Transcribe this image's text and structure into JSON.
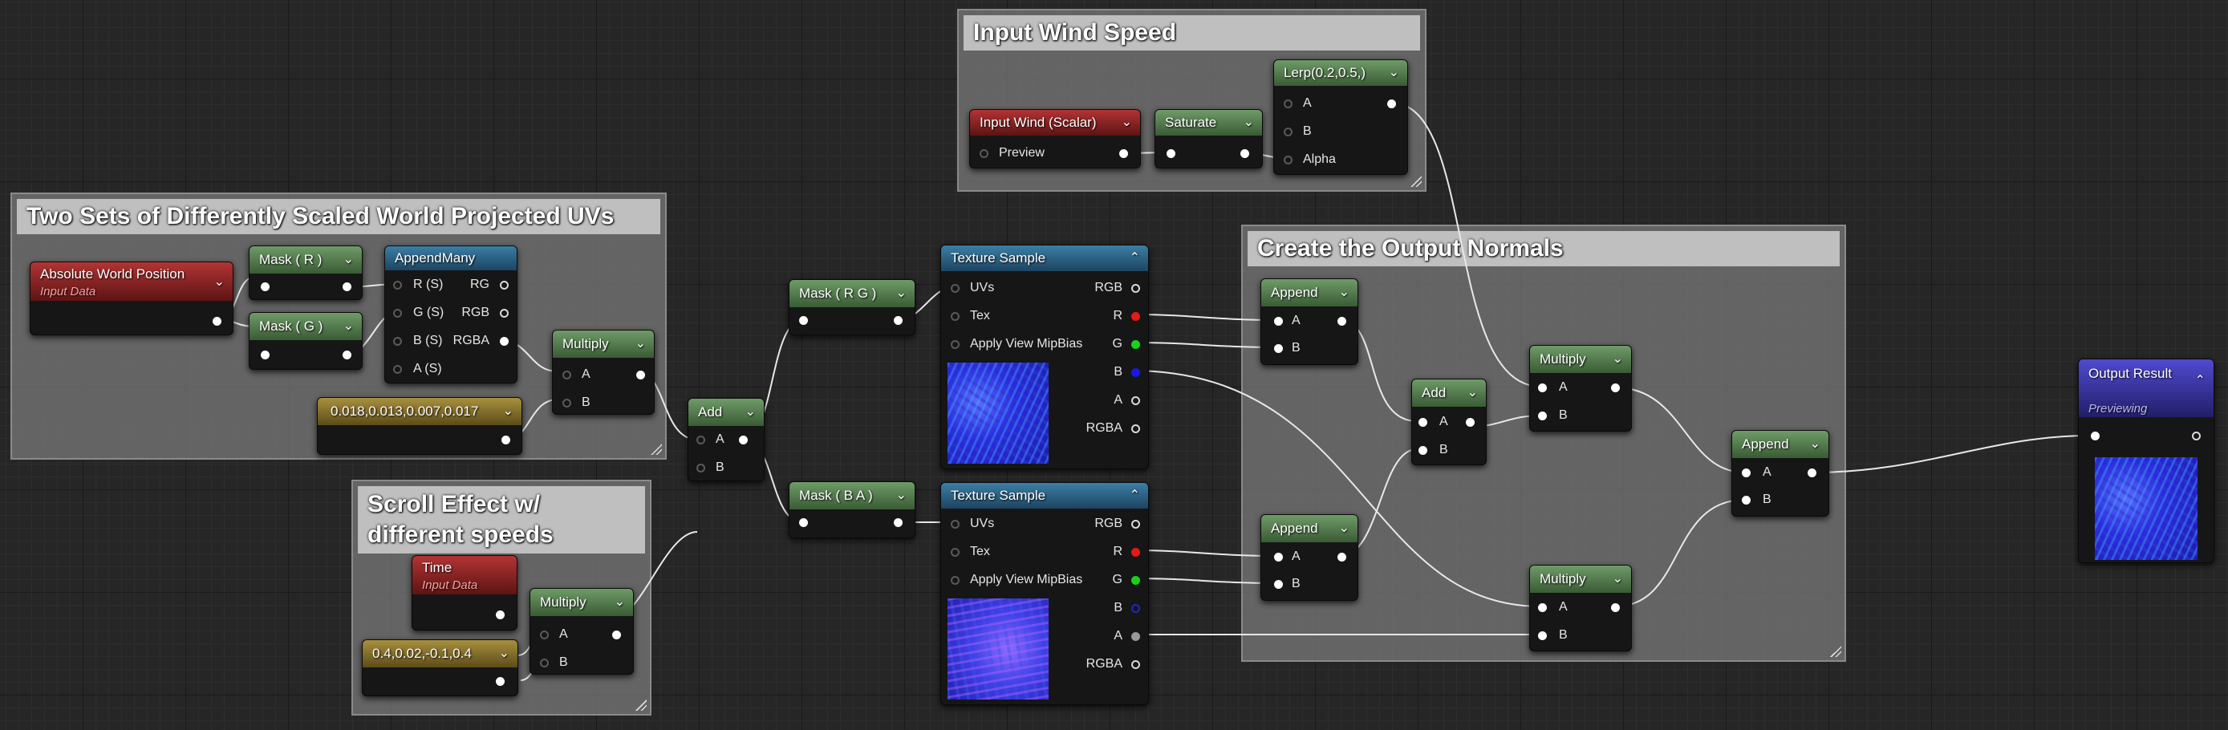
{
  "comments": {
    "wind": "Input Wind Speed",
    "uvs": "Two Sets of Differently Scaled World Projected UVs",
    "scroll": "Scroll Effect w/\ndifferent speeds",
    "normals": "Create the Output Normals"
  },
  "nodes": {
    "abs_world": {
      "title": "Absolute World Position",
      "sub": "Input Data"
    },
    "mask_r": {
      "title": "Mask ( R )"
    },
    "mask_g": {
      "title": "Mask ( G )"
    },
    "append_many": {
      "title": "AppendMany",
      "inputs": [
        "R (S)",
        "G (S)",
        "B (S)",
        "A (S)"
      ],
      "outputs": [
        "RG",
        "RGB",
        "RGBA"
      ]
    },
    "multiply_uv": {
      "title": "Multiply",
      "a": "A",
      "b": "B"
    },
    "const_scale": {
      "title": "0.018,0.013,0.007,0.017"
    },
    "time": {
      "title": "Time",
      "sub": "Input Data"
    },
    "multiply_time": {
      "title": "Multiply",
      "a": "A",
      "b": "B"
    },
    "const_speed": {
      "title": "0.4,0.02,-0.1,0.4"
    },
    "add_main": {
      "title": "Add",
      "a": "A",
      "b": "B"
    },
    "mask_rg": {
      "title": "Mask ( R G )"
    },
    "mask_ba": {
      "title": "Mask ( B A )"
    },
    "tex1": {
      "title": "Texture Sample",
      "inputs": [
        "UVs",
        "Tex",
        "Apply View MipBias"
      ],
      "outputs": [
        "RGB",
        "R",
        "G",
        "B",
        "A",
        "RGBA"
      ]
    },
    "tex2": {
      "title": "Texture Sample",
      "inputs": [
        "UVs",
        "Tex",
        "Apply View MipBias"
      ],
      "outputs": [
        "RGB",
        "R",
        "G",
        "B",
        "A",
        "RGBA"
      ]
    },
    "wind_param": {
      "title": "Input Wind (Scalar)",
      "preview": "Preview"
    },
    "saturate": {
      "title": "Saturate"
    },
    "lerp": {
      "title": "Lerp(0.2,0.5,)",
      "a": "A",
      "b": "B",
      "alpha": "Alpha"
    },
    "append1": {
      "title": "Append",
      "a": "A",
      "b": "B"
    },
    "append2": {
      "title": "Append",
      "a": "A",
      "b": "B"
    },
    "add_norm": {
      "title": "Add",
      "a": "A",
      "b": "B"
    },
    "multiply1": {
      "title": "Multiply",
      "a": "A",
      "b": "B"
    },
    "multiply2": {
      "title": "Multiply",
      "a": "A",
      "b": "B"
    },
    "append_out": {
      "title": "Append",
      "a": "A",
      "b": "B"
    },
    "output": {
      "title": "Output Result",
      "sub": "Previewing"
    }
  },
  "icons": {
    "collapse": "chevron-down-icon",
    "expand": "chevron-up-icon"
  },
  "colors": {
    "param_header": "#b23434",
    "math_header": "#3a5b35",
    "texture_header": "#2a5a7c",
    "constant_header": "#8a7432",
    "output_header": "#2b2890",
    "pin_r": "#e61919",
    "pin_g": "#19d219",
    "pin_b": "#1919e6"
  }
}
